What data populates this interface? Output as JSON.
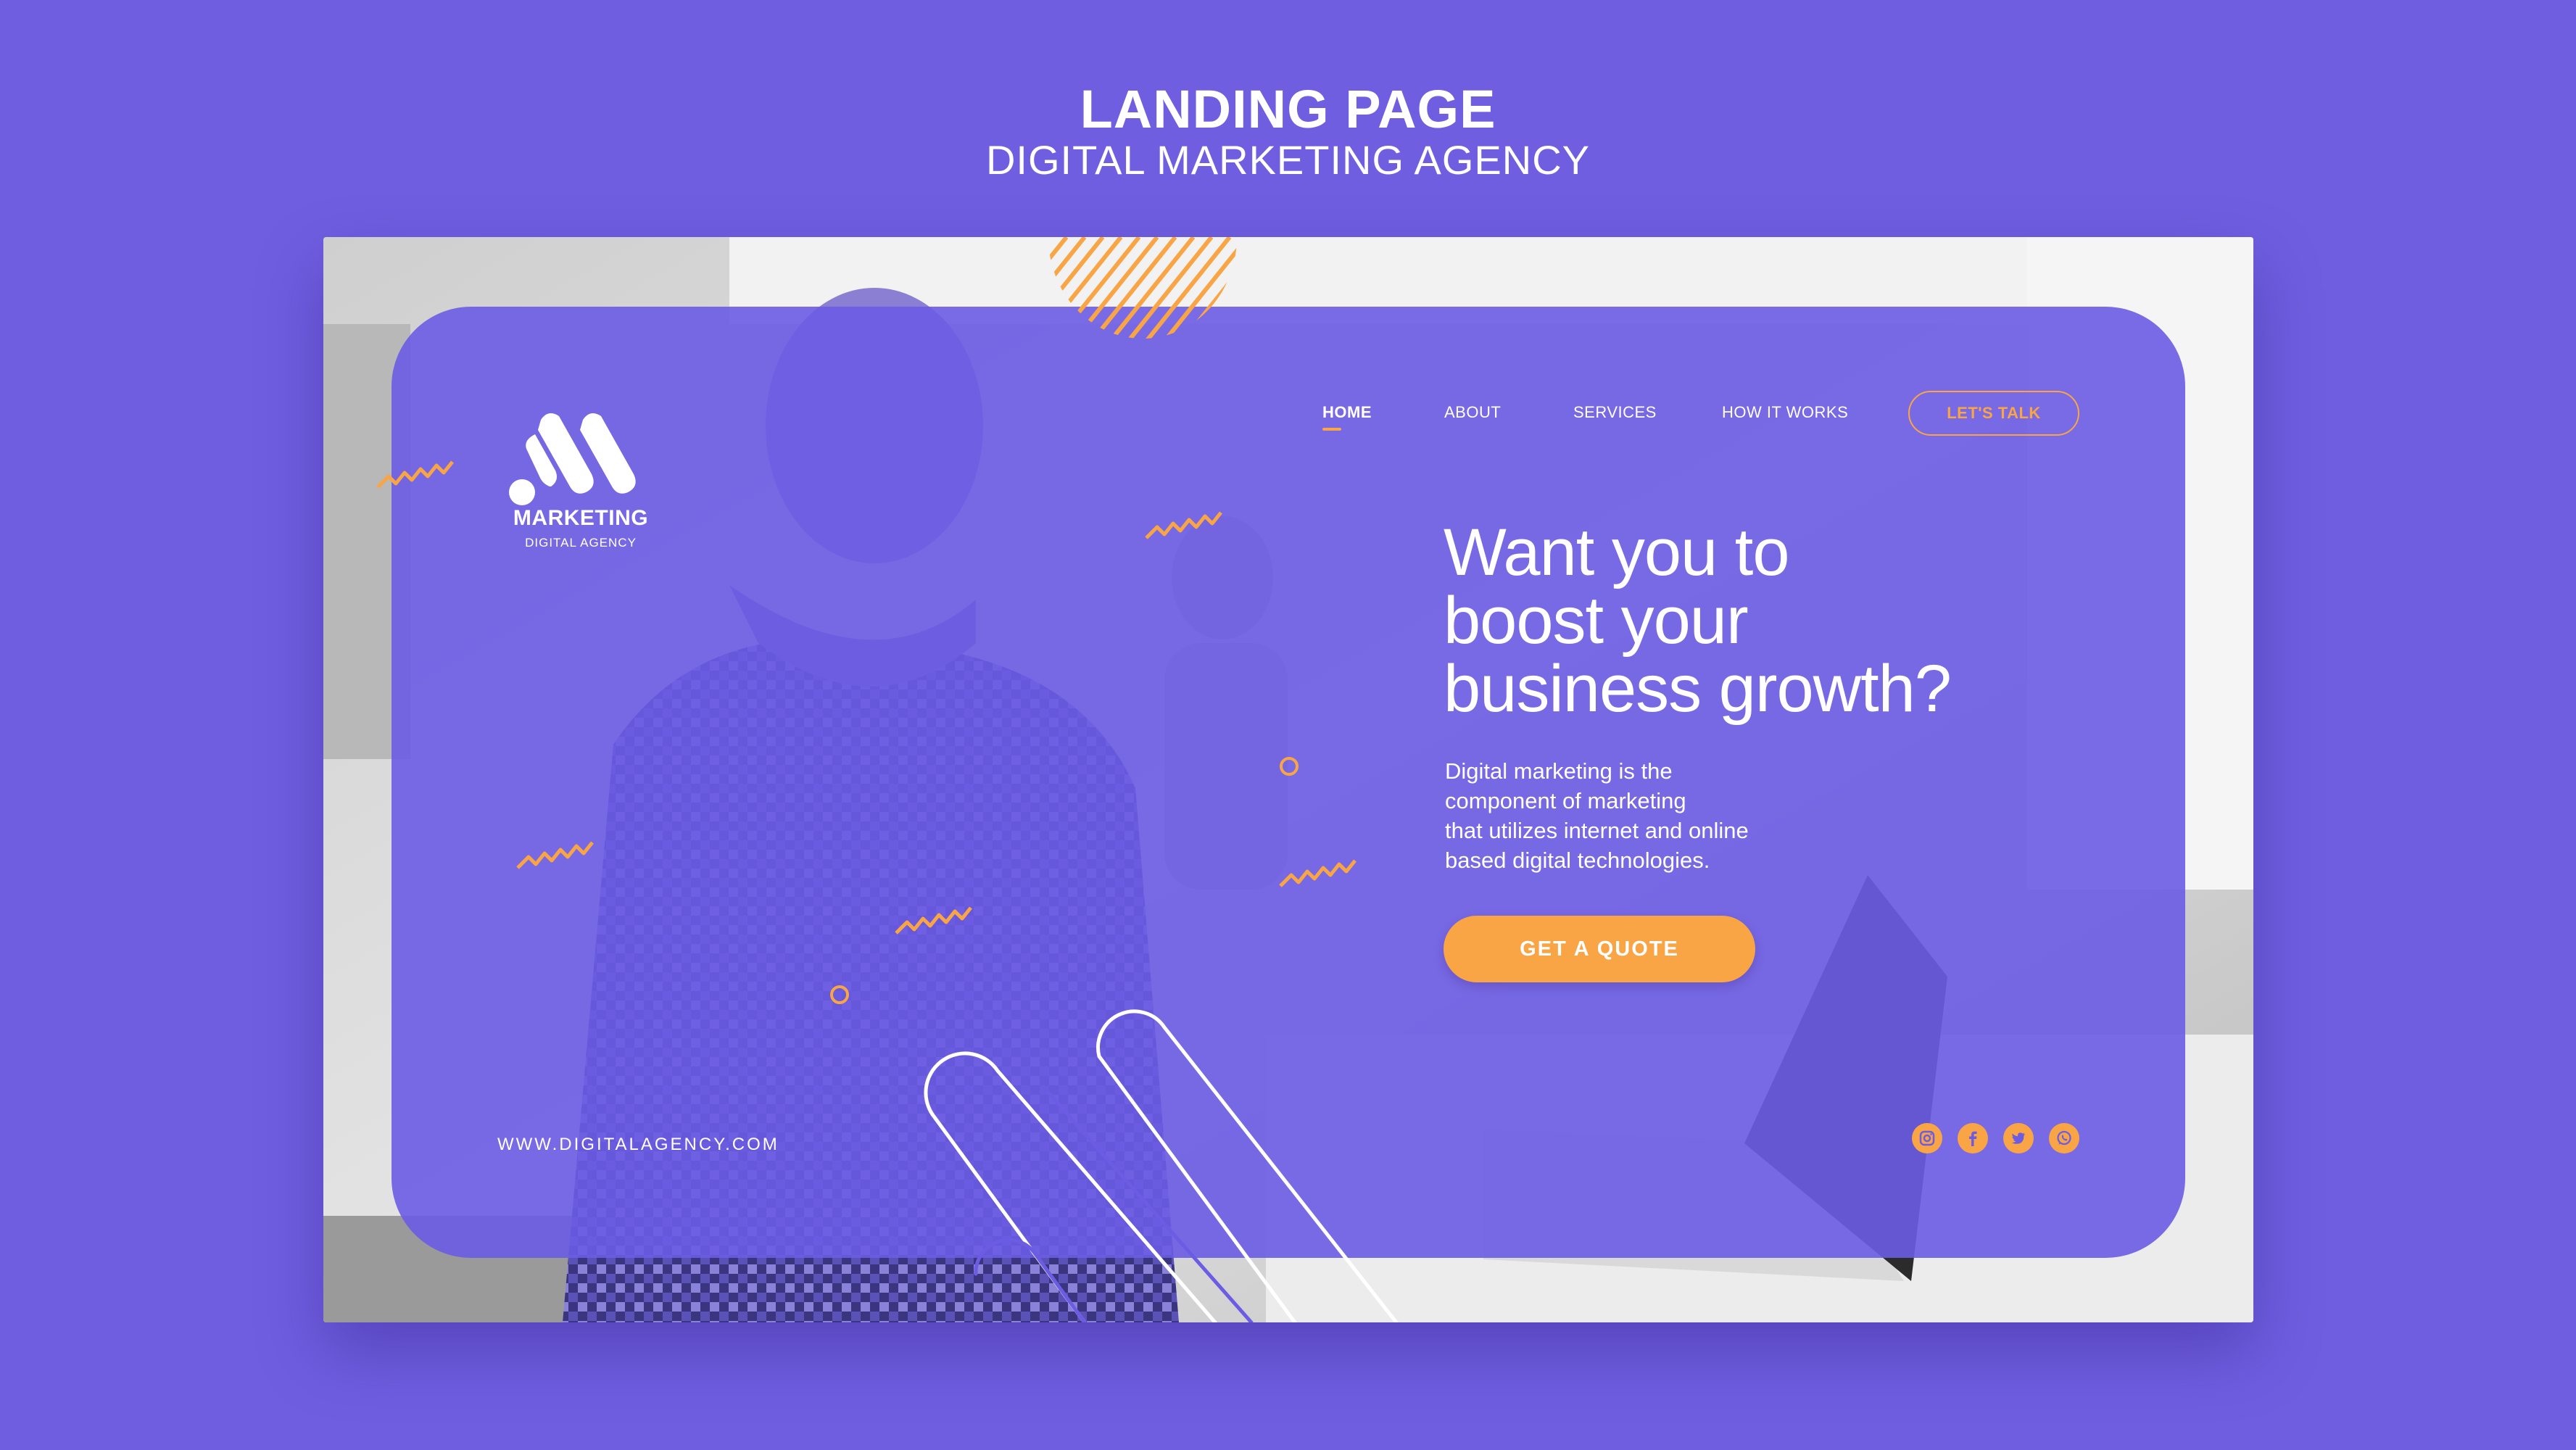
{
  "header": {
    "title": "LANDING PAGE",
    "subtitle": "DIGITAL MARKETING AGENCY"
  },
  "logo": {
    "name": "MARKETING",
    "tagline": "DIGITAL AGENCY"
  },
  "nav": {
    "items": [
      {
        "label": "HOME",
        "active": true
      },
      {
        "label": "ABOUT",
        "active": false
      },
      {
        "label": "SERVICES",
        "active": false
      },
      {
        "label": "HOW IT WORKS",
        "active": false
      }
    ],
    "cta_label": "LET'S TALK"
  },
  "hero": {
    "headline_lines": [
      "Want you to",
      "boost your",
      "business growth?"
    ],
    "description_lines": [
      "Digital marketing is the",
      "component of marketing",
      "that utilizes internet and online",
      "based digital technologies."
    ],
    "button_label": "GET A QUOTE"
  },
  "footer": {
    "website": "WWW.DIGITALAGENCY.COM",
    "social_icons": [
      "instagram-icon",
      "facebook-icon",
      "twitter-icon",
      "whatsapp-icon"
    ]
  },
  "colors": {
    "background": "#6f5fe0",
    "card": "#6c5ce4",
    "accent": "#f9a545",
    "text": "#ffffff"
  }
}
